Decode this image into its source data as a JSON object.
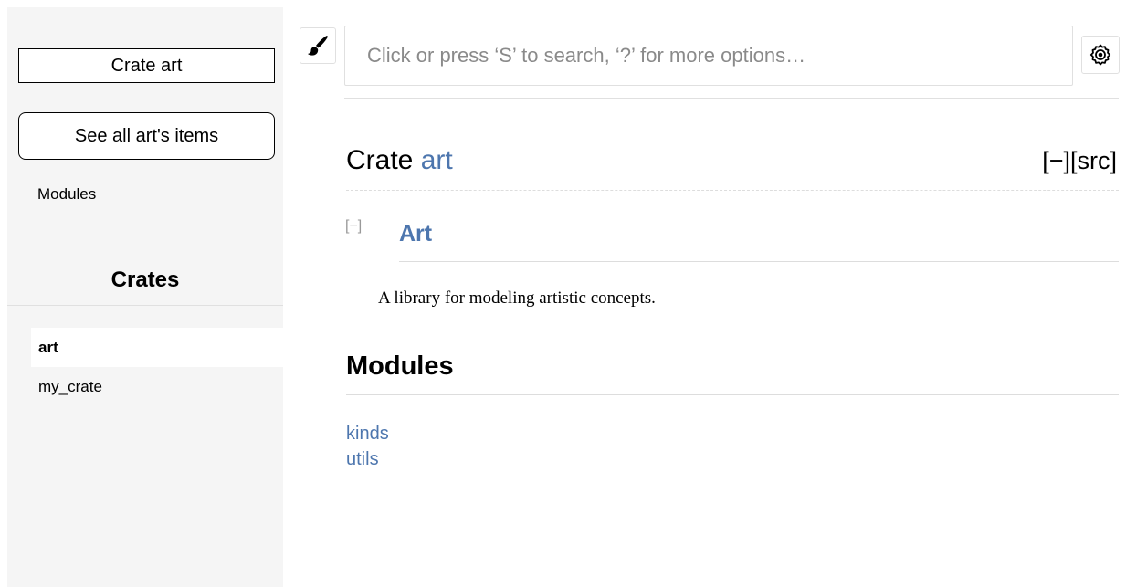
{
  "sidebar": {
    "title": "Crate art",
    "all_items_label": "See all art's items",
    "modules_link": "Modules",
    "crates_heading": "Crates",
    "crates": [
      {
        "label": "art",
        "current": true
      },
      {
        "label": "my_crate",
        "current": false
      }
    ]
  },
  "search": {
    "placeholder": "Click or press ‘S’ to search, ‘?’ for more options…",
    "value": ""
  },
  "icons": {
    "theme": "paintbrush-icon",
    "settings": "gear-icon"
  },
  "main": {
    "heading_prefix": "Crate",
    "heading_name": "art",
    "toggle_all": "[−]",
    "src": "[src]",
    "doc_toggle": "[−]",
    "doc_title": "Art",
    "doc_text": "A library for modeling artistic concepts.",
    "modules_heading": "Modules",
    "modules": [
      "kinds",
      "utils"
    ]
  },
  "colors": {
    "link": "#4d76ae",
    "sidebar_bg": "#f5f5f5",
    "muted": "#999999"
  }
}
